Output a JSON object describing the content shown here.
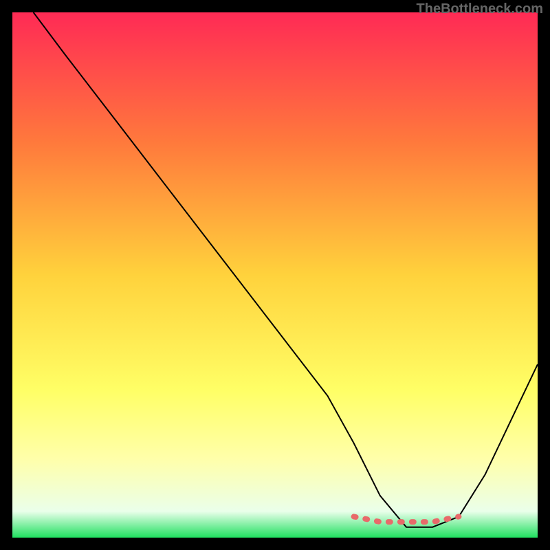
{
  "watermark": "TheBottleneck.com",
  "chart_data": {
    "type": "line",
    "title": "",
    "xlabel": "",
    "ylabel": "",
    "xlim": [
      0,
      100
    ],
    "ylim": [
      0,
      100
    ],
    "gradient_stops": [
      {
        "offset": 0,
        "color": "#ff2a55"
      },
      {
        "offset": 25,
        "color": "#ff7a3c"
      },
      {
        "offset": 50,
        "color": "#ffd23c"
      },
      {
        "offset": 72,
        "color": "#ffff66"
      },
      {
        "offset": 85,
        "color": "#ffffaa"
      },
      {
        "offset": 95,
        "color": "#eaffea"
      },
      {
        "offset": 100,
        "color": "#20e060"
      }
    ],
    "curve": {
      "x": [
        4,
        10,
        20,
        30,
        40,
        50,
        60,
        65,
        70,
        75,
        80,
        85,
        90,
        100
      ],
      "y": [
        100,
        92,
        79,
        66,
        53,
        40,
        27,
        18,
        8,
        2,
        2,
        4,
        12,
        33
      ]
    },
    "dashed_segment": {
      "x": [
        65,
        70,
        75,
        80,
        82.5,
        85
      ],
      "y": [
        4,
        3,
        3,
        3,
        3.5,
        4
      ]
    },
    "dashed_color": "#e86a6a"
  }
}
